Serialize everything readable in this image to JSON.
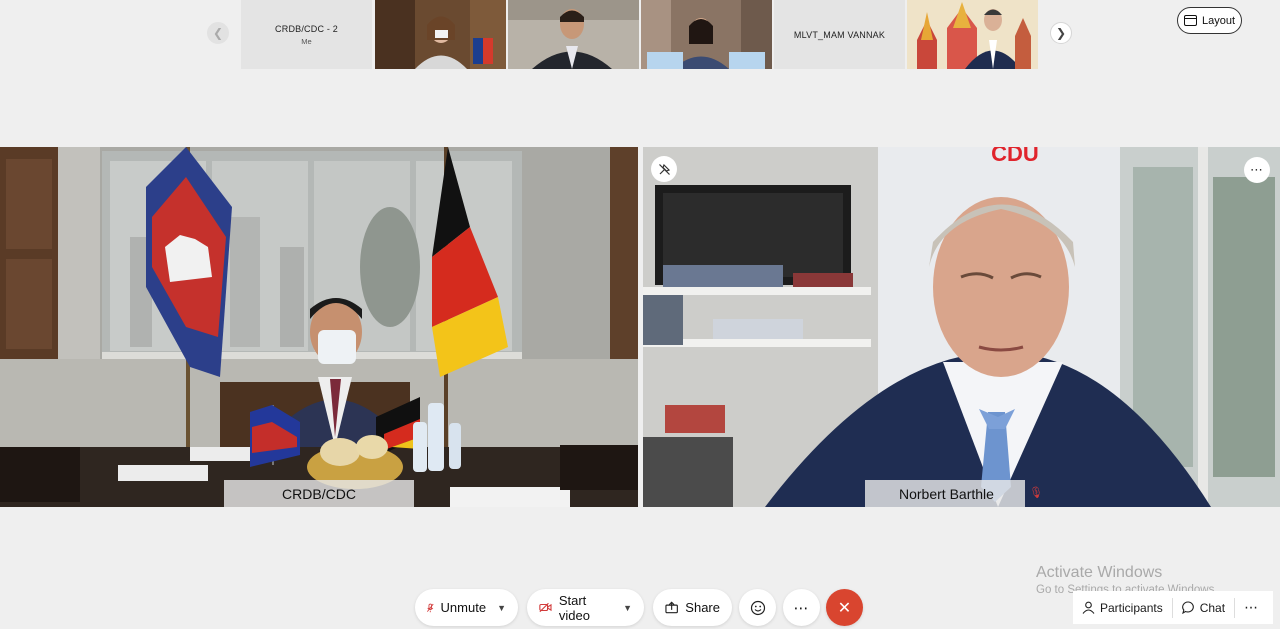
{
  "filmstrip": {
    "prev_icon": "chevron-left-icon",
    "next_icon": "chevron-right-icon",
    "thumbs": [
      {
        "name": "CRDB/CDC - 2",
        "sub": "Me",
        "kind": "text"
      },
      {
        "kind": "video"
      },
      {
        "kind": "video"
      },
      {
        "kind": "video"
      },
      {
        "name": "MLVT_MAM VANNAK",
        "kind": "text"
      },
      {
        "kind": "video"
      }
    ]
  },
  "layout_button": {
    "label": "Layout",
    "icon": "layout-icon"
  },
  "tiles": {
    "left": {
      "name": "CRDB/CDC"
    },
    "right": {
      "name": "Norbert Barthle",
      "sign": "CDU"
    }
  },
  "controls": {
    "unmute": "Unmute",
    "start_video": "Start video",
    "share": "Share",
    "end_call_icon": "close-icon"
  },
  "activate": {
    "title": "Activate Windows",
    "subtitle": "Go to Settings to activate Windows."
  },
  "panel": {
    "participants": "Participants",
    "chat": "Chat"
  }
}
